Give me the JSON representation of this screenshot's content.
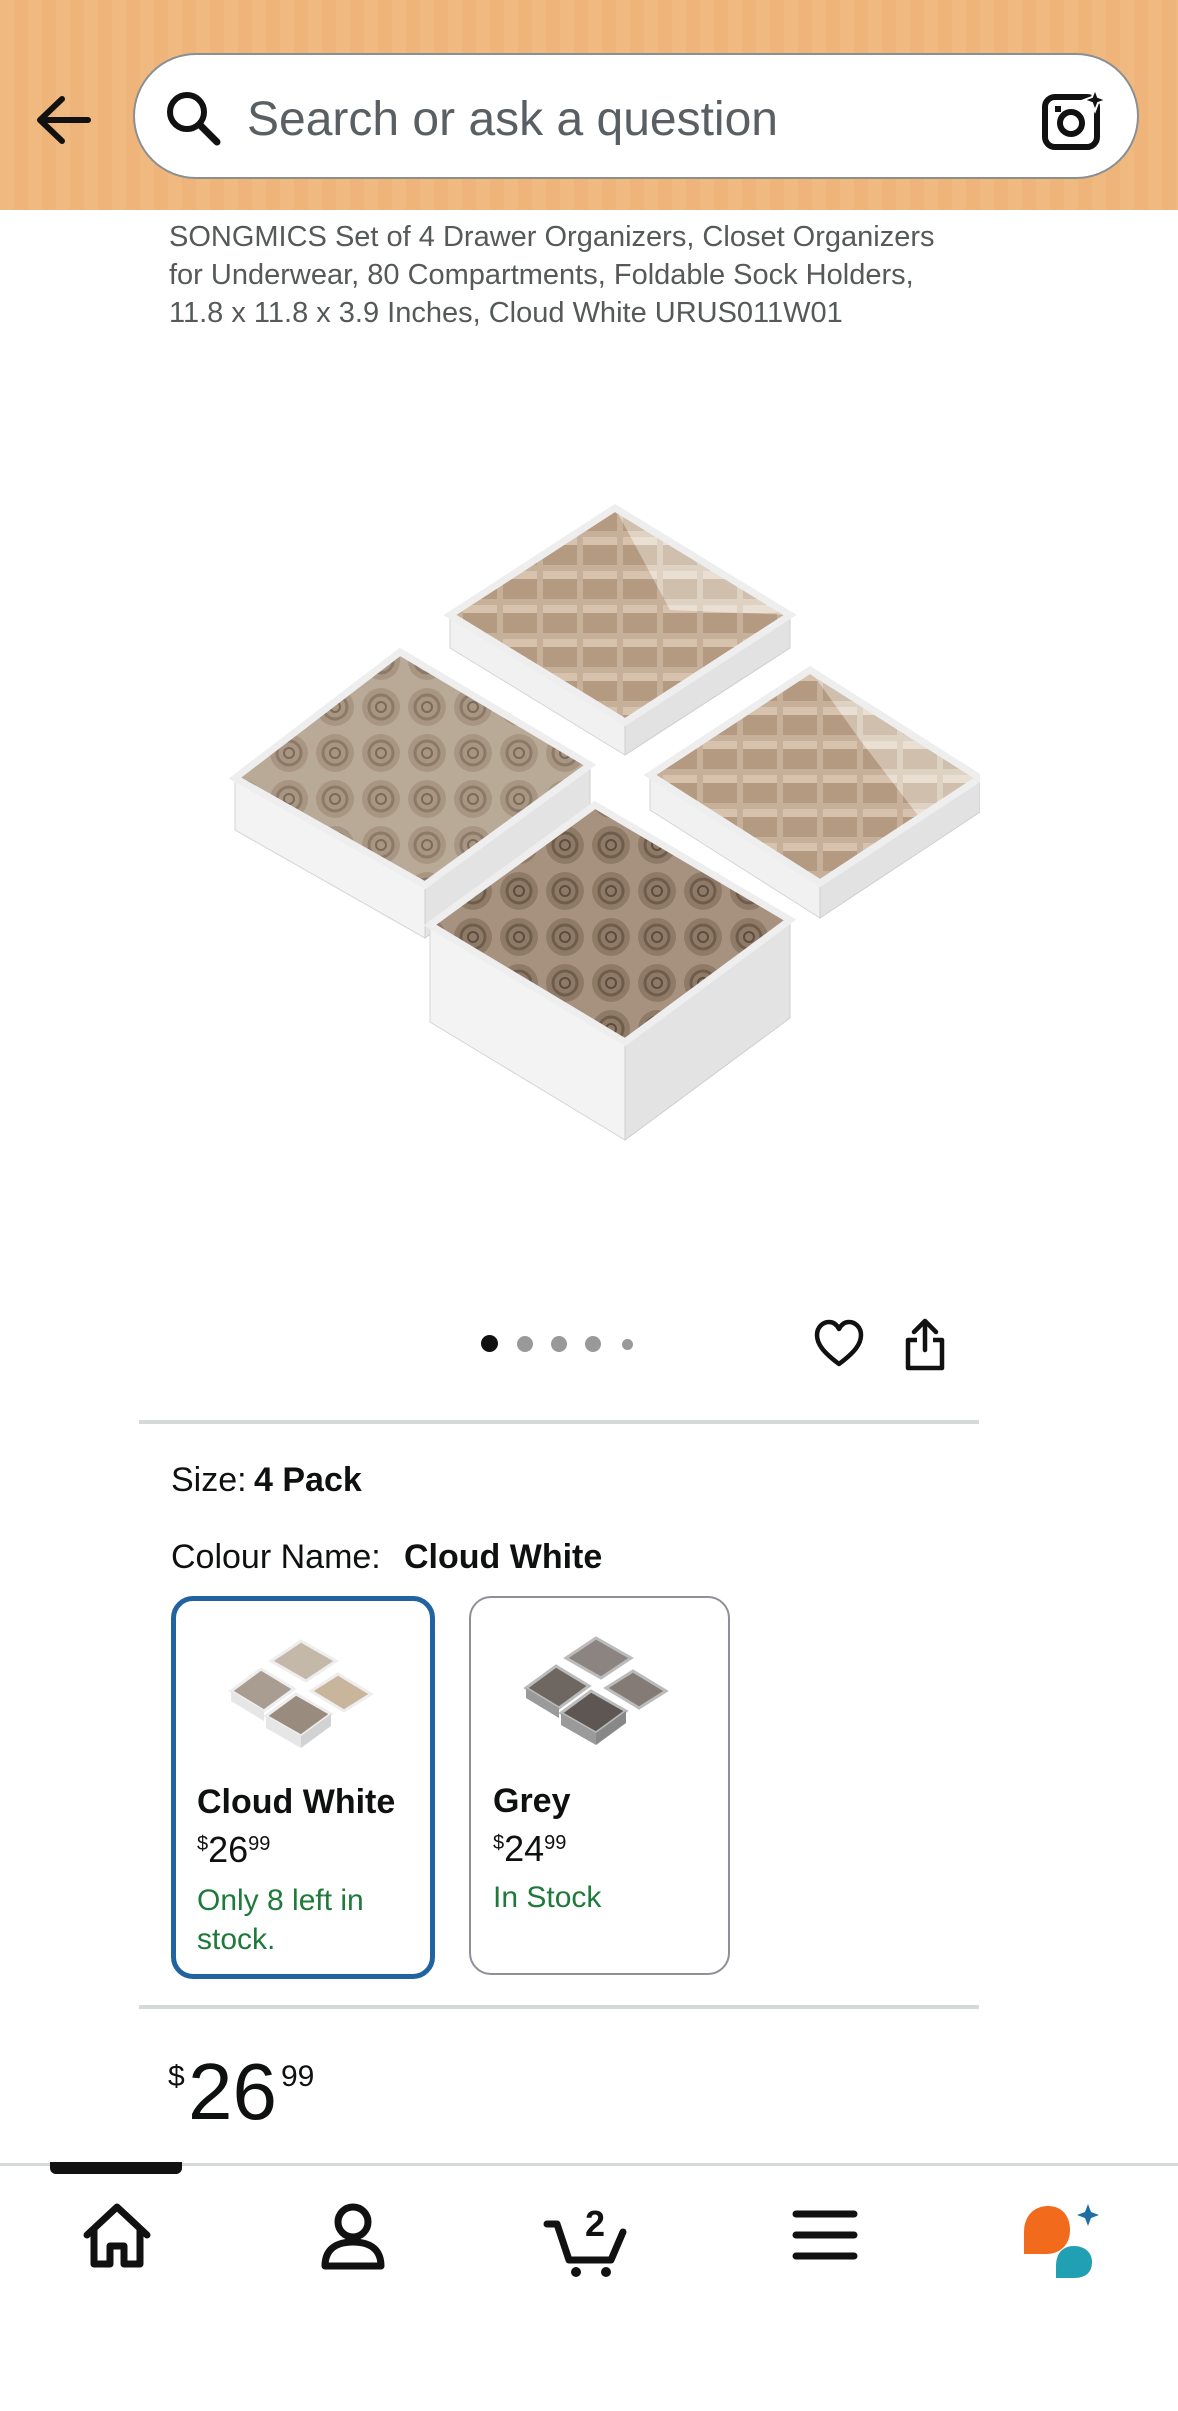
{
  "header": {
    "search_placeholder": "Search or ask a question",
    "bg_color": "#f0b97f"
  },
  "product": {
    "title": "SONGMICS Set of 4 Drawer Organizers, Closet Organizers for Underwear, 80 Compartments, Foldable Sock Holders, 11.8 x 11.8 x 3.9 Inches, Cloud White URUS011W01",
    "image_count": 5,
    "current_image": 1
  },
  "options": {
    "size_label": "Size:",
    "size_value": "4 Pack",
    "colour_label": "Colour Name:",
    "colour_value": "Cloud White",
    "swatches": [
      {
        "name": "Cloud White",
        "currency": "$",
        "whole": "26",
        "fraction": "99",
        "stock": "Only 8 left in stock.",
        "selected": true
      },
      {
        "name": "Grey",
        "currency": "$",
        "whole": "24",
        "fraction": "99",
        "stock": "In Stock",
        "selected": false
      }
    ]
  },
  "price": {
    "currency": "$",
    "whole": "26",
    "fraction": "99"
  },
  "bottom_nav": {
    "items": [
      "home-icon",
      "account-icon",
      "cart-icon",
      "menu-icon",
      "rufus-icon"
    ],
    "cart_count": "2"
  },
  "colors": {
    "accent_blue": "#2162a1",
    "stock_green": "#1e7a3a",
    "rufus_orange": "#f26b1d",
    "rufus_teal": "#22a0b3"
  }
}
